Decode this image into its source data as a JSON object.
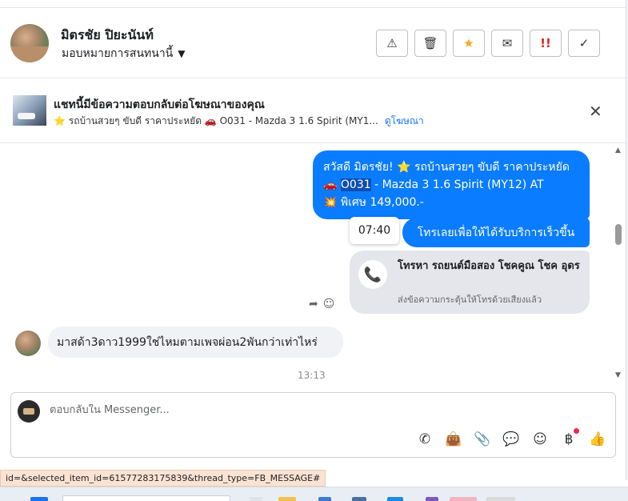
{
  "header": {
    "name": "มิตรชัย ปิยะนันท์",
    "assign_label": "มอบหมายการสนทนานี้",
    "actions": [
      {
        "icon": "warning-icon",
        "glyph": "⚠"
      },
      {
        "icon": "trash-icon",
        "glyph": "🗑"
      },
      {
        "icon": "star-icon",
        "glyph": "★"
      },
      {
        "icon": "mail-icon",
        "glyph": "✉"
      },
      {
        "icon": "urgent-icon",
        "glyph": "!!"
      },
      {
        "icon": "check-icon",
        "glyph": "✓"
      }
    ]
  },
  "ad_banner": {
    "title": "แชทนี้มีข้อความตอบกลับต่อโฆษณาของคุณ",
    "ad_text": "⭐ รถบ้านสวยๆ ขับดี ราคาประหยัด 🚗 O031 - Mazda 3 1.6 Spirit (MY1...",
    "link": "ดูโฆษณา"
  },
  "messages": {
    "m1_line1": "สวัสดี มิตรชัย! ⭐ รถบ้านสวยๆ ขับดี ราคาประหยัด",
    "m1_line2_prefix": "🚗 ",
    "m1_line2_highlight": "O031",
    "m1_line2_rest": " - Mazda 3 1.6 Spirit (MY12) AT",
    "m1_line3": "💥 พิเศษ 149,000.-",
    "time_tooltip": "07:40",
    "m2": "โทรเลยเพื่อให้ได้รับบริการเร็วขึ้น",
    "call_title": "โทรหา รถยนต์มือสอง โชคคูณ โชค อุดร",
    "call_subtitle": "ส่งข้อความกระตุ้นให้โทรด้วยเสียงแล้ว",
    "incoming": "มาสด้า3ดาว1999ใช่ไหมตามเพจผ่อน2พันกว่าเท่าไหร่",
    "timestamp": "13:13"
  },
  "composer": {
    "placeholder": "ตอบกลับใน Messenger..."
  },
  "status_url": "id=&selected_item_id=61577283175839&thread_type=FB_MESSAGE#"
}
